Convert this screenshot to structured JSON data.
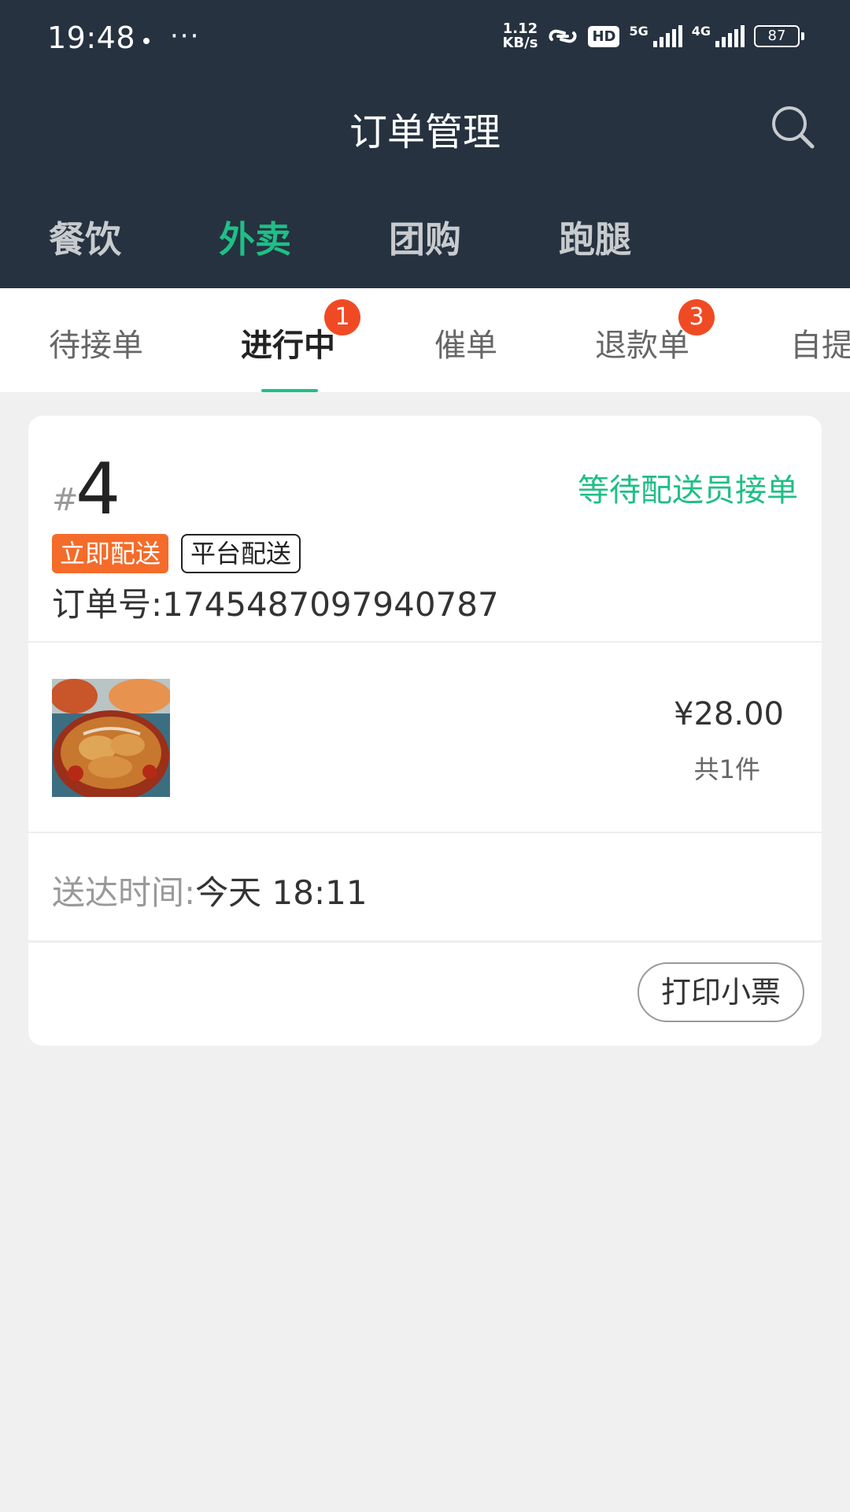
{
  "status_bar": {
    "time": "19:48",
    "more": "···",
    "net_speed_value": "1.12",
    "net_speed_unit": "KB/s",
    "hd_label": "HD",
    "sig1_label": "5G",
    "sig2_label": "4G",
    "battery": "87"
  },
  "header": {
    "title": "订单管理",
    "search_icon": "search-icon"
  },
  "top_tabs": [
    {
      "label": "餐饮",
      "active": false
    },
    {
      "label": "外卖",
      "active": true
    },
    {
      "label": "团购",
      "active": false
    },
    {
      "label": "跑腿",
      "active": false
    }
  ],
  "sub_tabs": [
    {
      "label": "待接单"
    },
    {
      "label": "进行中",
      "active": true,
      "badge": "1"
    },
    {
      "label": "催单"
    },
    {
      "label": "退款单",
      "badge": "3"
    },
    {
      "label": "自提"
    }
  ],
  "order": {
    "hash": "#",
    "number": "4",
    "status": "等待配送员接单",
    "tag_delivery_type": "立即配送",
    "tag_platform": "平台配送",
    "order_id_label": "订单号:",
    "order_id": "1745487097940787",
    "price": "¥28.00",
    "quantity": "共1件",
    "delivery_time_label": "送达时间:",
    "delivery_time_value": "今天 18:11",
    "print_button": "打印小票"
  },
  "colors": {
    "header_bg": "#263240",
    "accent_green": "#1fbf86",
    "badge_red": "#f04a24",
    "tag_orange": "#f46b2a"
  }
}
